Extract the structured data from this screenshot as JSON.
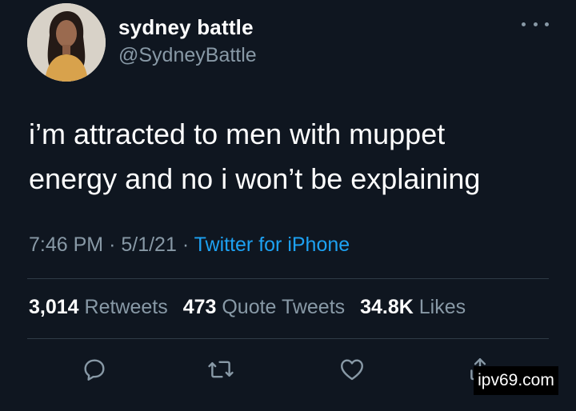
{
  "tweet": {
    "display_name": "sydney battle",
    "handle": "@SydneyBattle",
    "text_line1": "i’m attracted to men with muppet",
    "text_line2": "energy and no i won’t be explaining",
    "time": "7:46 PM",
    "date": "5/1/21",
    "separator": "·",
    "source": "Twitter for iPhone"
  },
  "stats": {
    "retweets_count": "3,014",
    "retweets_label": "Retweets",
    "quotes_count": "473",
    "quotes_label": "Quote Tweets",
    "likes_count": "34.8K",
    "likes_label": "Likes"
  },
  "actions": {
    "reply_icon": "reply-icon",
    "retweet_icon": "retweet-icon",
    "like_icon": "heart-icon",
    "share_icon": "share-icon"
  },
  "watermark": {
    "text": "ipv69.com"
  },
  "colors": {
    "background": "#0f1620",
    "secondary_text": "#8899a6",
    "link": "#1da1f2",
    "divider": "#2f3b47"
  }
}
